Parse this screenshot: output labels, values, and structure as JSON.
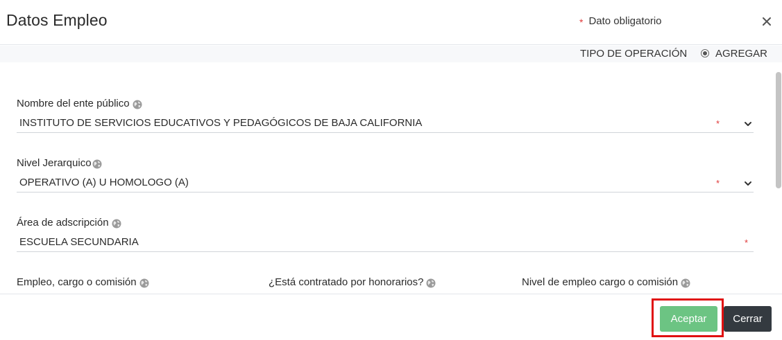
{
  "header": {
    "title": "Datos Empleo",
    "required_marker": "*",
    "required_legend": "Dato obligatorio",
    "close_glyph": "×"
  },
  "operation": {
    "label": "TIPO DE OPERACIÓN",
    "value": "AGREGAR"
  },
  "fields": {
    "ente_publico": {
      "label": "Nombre del ente público",
      "value": "INSTITUTO DE SERVICIOS EDUCATIVOS Y PEDAGÓGICOS DE BAJA CALIFORNIA",
      "required_marker": "*"
    },
    "nivel_jerarquico": {
      "label": "Nivel Jerarquico",
      "value": "OPERATIVO (A) U HOMOLOGO (A)",
      "required_marker": "*"
    },
    "area_adscripcion": {
      "label": "Área de adscripción",
      "value": "ESCUELA SECUNDARIA",
      "required_marker": "*"
    },
    "empleo_cargo": {
      "label": "Empleo, cargo o comisión"
    },
    "honorarios": {
      "label": "¿Está contratado por honorarios?"
    },
    "nivel_empleo": {
      "label": "Nivel de empleo cargo o comisión"
    }
  },
  "footer": {
    "accept_label": "Aceptar",
    "close_label": "Cerrar"
  },
  "icons": {
    "info": "globe-icon",
    "dropdown": "chevron-down-icon",
    "close": "close-icon",
    "radio": "radio-selected-icon"
  },
  "colors": {
    "accept_button": "#6cc483",
    "close_button": "#343a40",
    "required": "#e03a3a",
    "highlight": "#e01010"
  }
}
